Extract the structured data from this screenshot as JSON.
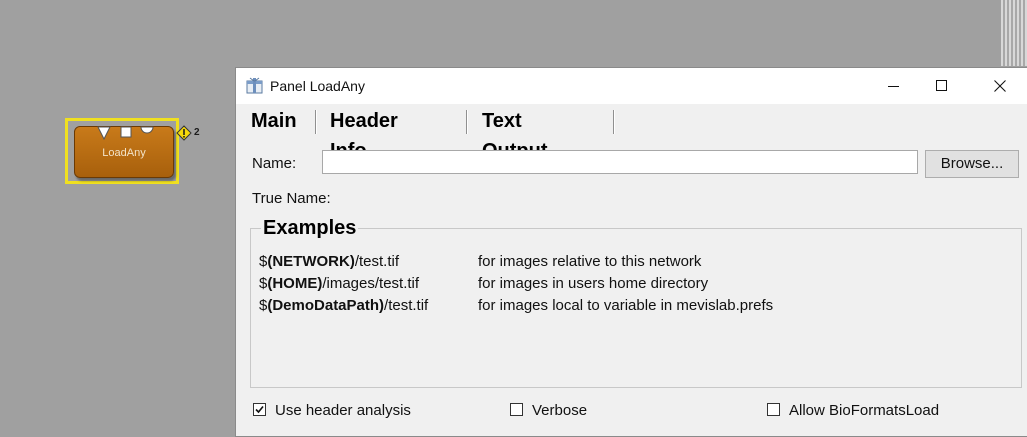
{
  "module": {
    "label": "LoadAny",
    "warning_count": "2",
    "color": "#b8690f"
  },
  "panel": {
    "title": "Panel LoadAny",
    "tabs": [
      {
        "label": "Main"
      },
      {
        "label": "Header Info"
      },
      {
        "label": "Text Output"
      }
    ],
    "name_label": "Name:",
    "name_value": "",
    "browse_label": "Browse...",
    "true_name_label": "True Name:",
    "examples": {
      "title": "Examples",
      "rows": [
        {
          "prefix": "$",
          "var": "(NETWORK)",
          "path": "/test.tif",
          "desc": "for images relative to this network"
        },
        {
          "prefix": "$",
          "var": "(HOME)",
          "path": "/images/test.tif",
          "desc": "for images in users home directory"
        },
        {
          "prefix": "$",
          "var": "(DemoDataPath)",
          "path": "/test.tif",
          "desc": "for images local to variable in mevislab.prefs"
        }
      ]
    },
    "checkboxes": [
      {
        "label": "Use header analysis",
        "checked": true
      },
      {
        "label": "Verbose",
        "checked": false
      },
      {
        "label": "Allow BioFormatsLoad",
        "checked": false
      }
    ]
  },
  "icons": {
    "title": "panel-icon",
    "minimize": "minimize-icon",
    "maximize": "maximize-icon",
    "close": "close-icon",
    "warning": "warning-icon"
  }
}
